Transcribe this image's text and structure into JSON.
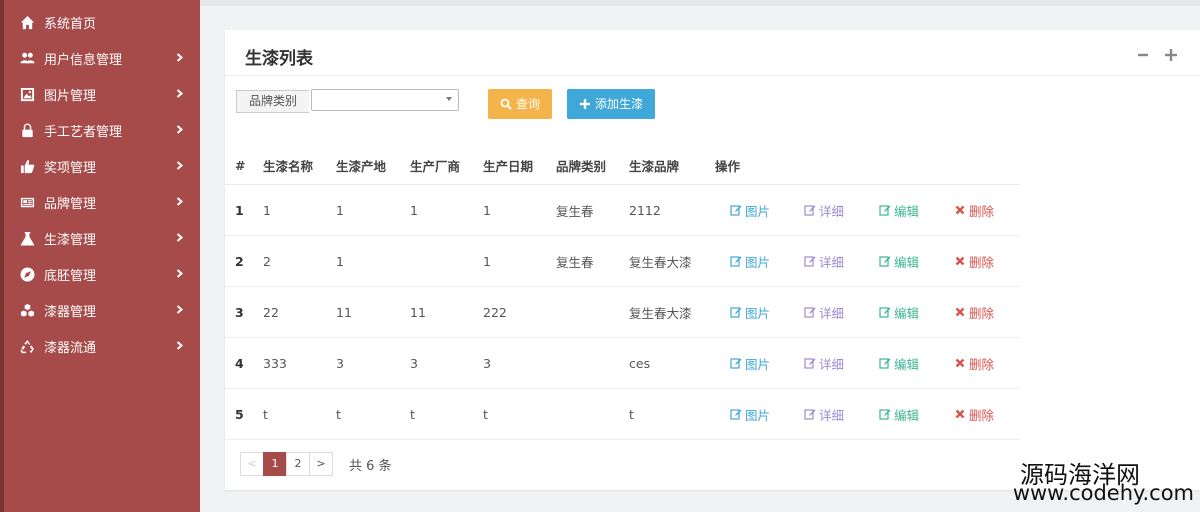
{
  "sidebar": {
    "items": [
      {
        "label": "系统首页",
        "icon": "home-icon",
        "has_chevron": false
      },
      {
        "label": "用户信息管理",
        "icon": "users-icon",
        "has_chevron": true
      },
      {
        "label": "图片管理",
        "icon": "picture-icon",
        "has_chevron": true
      },
      {
        "label": "手工艺者管理",
        "icon": "lock-icon",
        "has_chevron": true
      },
      {
        "label": "奖项管理",
        "icon": "thumbs-up-icon",
        "has_chevron": true
      },
      {
        "label": "品牌管理",
        "icon": "newspaper-icon",
        "has_chevron": true
      },
      {
        "label": "生漆管理",
        "icon": "flask-icon",
        "has_chevron": true
      },
      {
        "label": "底胚管理",
        "icon": "compass-icon",
        "has_chevron": true
      },
      {
        "label": "漆器管理",
        "icon": "cubes-icon",
        "has_chevron": true
      },
      {
        "label": "漆器流通",
        "icon": "recycle-icon",
        "has_chevron": true
      }
    ]
  },
  "panel": {
    "title": "生漆列表",
    "filter_label": "品牌类别",
    "filter_value": "",
    "search_label": "查询",
    "add_label": "添加生漆"
  },
  "table": {
    "columns": [
      "#",
      "生漆名称",
      "生漆产地",
      "生产厂商",
      "生产日期",
      "品牌类别",
      "生漆品牌",
      "操作"
    ],
    "actions": {
      "image": "图片",
      "detail": "详细",
      "edit": "编辑",
      "delete": "删除"
    },
    "rows": [
      [
        "1",
        "1",
        "1",
        "1",
        "1",
        "复生春",
        "2112"
      ],
      [
        "2",
        "2",
        "1",
        "",
        "1",
        "复生春",
        "复生春大漆"
      ],
      [
        "3",
        "22",
        "11",
        "11",
        "222",
        "",
        "复生春大漆"
      ],
      [
        "4",
        "333",
        "3",
        "3",
        "3",
        "",
        "ces"
      ],
      [
        "5",
        "t",
        "t",
        "t",
        "t",
        "",
        "t"
      ]
    ]
  },
  "pagination": {
    "prev": "<",
    "pages": [
      "1",
      "2"
    ],
    "current": "1",
    "next": ">",
    "total_text": "共 6 条"
  },
  "watermark": {
    "line1": "源码海洋网",
    "line2": "www.codehy.com"
  },
  "colors": {
    "sidebar": "#a74a4a",
    "search_button": "#f3b54a",
    "add_button": "#3fa8d8"
  }
}
